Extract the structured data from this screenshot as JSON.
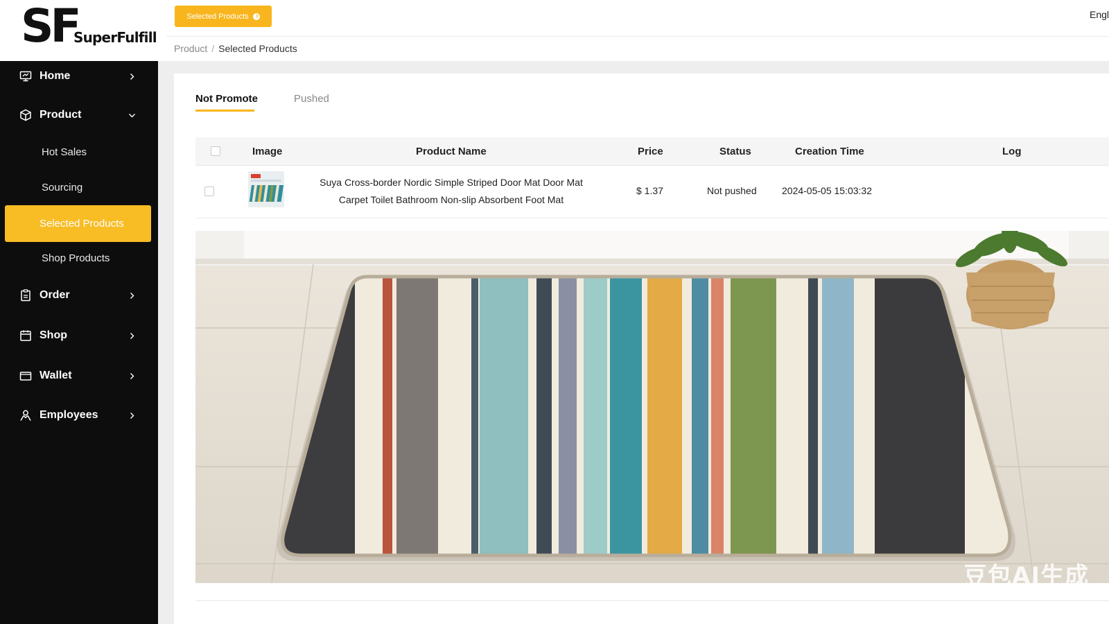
{
  "logo": {
    "mark": "SF",
    "name": "SuperFulfill"
  },
  "header": {
    "top_button_label": "Selected Products",
    "language": "English",
    "breadcrumb": [
      "Product",
      "Selected Products"
    ]
  },
  "sidebar": {
    "items": [
      {
        "label": "Home",
        "icon": "monitor-icon",
        "chevron": "right"
      },
      {
        "label": "Product",
        "icon": "box-icon",
        "chevron": "down"
      },
      {
        "label": "Hot Sales",
        "sub": true
      },
      {
        "label": "Sourcing",
        "sub": true
      },
      {
        "label": "Selected Products",
        "sub": true,
        "active": true
      },
      {
        "label": "Shop Products",
        "sub": true
      },
      {
        "label": "Order",
        "icon": "clipboard-icon",
        "chevron": "right"
      },
      {
        "label": "Shop",
        "icon": "store-icon",
        "chevron": "right"
      },
      {
        "label": "Wallet",
        "icon": "wallet-icon",
        "chevron": "right"
      },
      {
        "label": "Employees",
        "icon": "person-icon",
        "chevron": "right"
      }
    ]
  },
  "tabs": [
    {
      "label": "Not Promote",
      "active": true
    },
    {
      "label": "Pushed",
      "active": false
    }
  ],
  "table": {
    "columns": [
      "Image",
      "Product Name",
      "Price",
      "Status",
      "Creation Time",
      "Log"
    ],
    "rows": [
      {
        "name": "Suya Cross-border Nordic Simple Striped Door Mat Door Mat Carpet Toilet Bathroom Non-slip Absorbent Foot Mat",
        "price": "$ 1.37",
        "status": "Not pushed",
        "created": "2024-05-05 15:03:32",
        "log": ""
      }
    ]
  },
  "watermark": "豆包AI生成",
  "colors": {
    "accent": "#f8b51d",
    "sidebar_bg": "#0d0d0d",
    "page_bg": "#eeeeee"
  }
}
